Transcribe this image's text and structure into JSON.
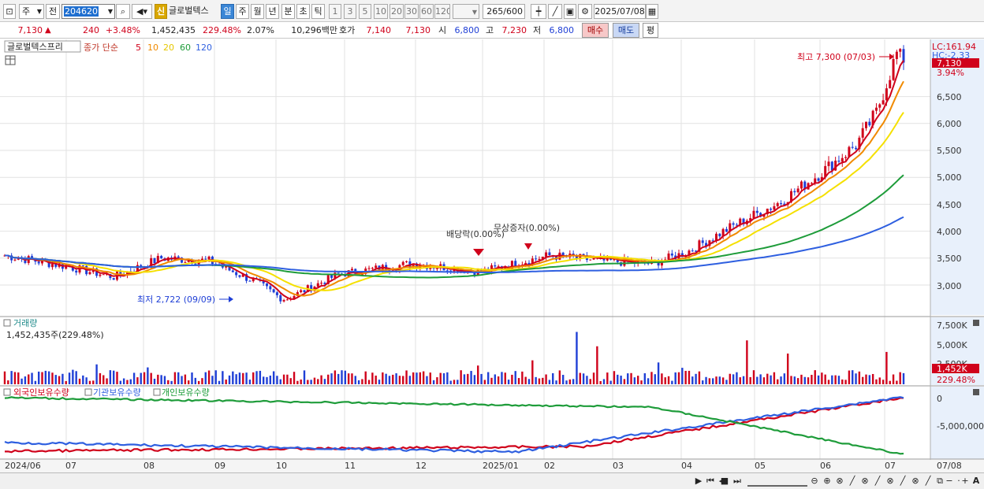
{
  "toolbar": {
    "type_select": "주",
    "prev_label": "전",
    "code": "204620",
    "stock_badge": "신",
    "stock_name": "글로벌텍스",
    "period_tabs": [
      "일",
      "주",
      "월",
      "년",
      "분",
      "초",
      "틱"
    ],
    "active_period": "일",
    "interval_buttons": [
      "1",
      "3",
      "5",
      "10",
      "20",
      "30",
      "60",
      "120"
    ],
    "count": "265",
    "count_max": "/600",
    "date": "2025/07/08"
  },
  "quote": {
    "price": "7,130",
    "change": "240",
    "change_pct": "+3.48%",
    "volume": "1,452,435",
    "volume_ratio": "229.48%",
    "turnover": "2.07%",
    "amount": "10,296백만",
    "hoga_label": "호가",
    "hoga_ask": "7,140",
    "hoga_bid": "7,130",
    "open_label": "시",
    "open": "6,800",
    "high_label": "고",
    "high": "7,230",
    "low_label": "저",
    "low": "6,800",
    "buy_label": "매수",
    "sell_label": "매도",
    "eval_label": "평"
  },
  "price_panel": {
    "title": "글로벌텍스프리",
    "ma_label": "종가 단순",
    "ma_periods": [
      "5",
      "10",
      "20",
      "60",
      "120"
    ],
    "ma_colors": [
      "#d0021b",
      "#f08a00",
      "#f5e000",
      "#1e9c3a",
      "#2e5fe0"
    ],
    "lc": "LC:161.94",
    "hc": "HC:-2.33",
    "last_price": "7,130",
    "last_pct": "3.94%",
    "high_note": "최고 7,300 (07/03)",
    "low_note": "최저 2,722 (09/09)",
    "event1": "배당락(0.00%)",
    "event2": "무상증자(0.00%)",
    "axis": [
      "6,500",
      "6,000",
      "5,500",
      "5,000",
      "4,500",
      "4,000",
      "3,500",
      "3,000"
    ]
  },
  "volume_panel": {
    "title": "거래량",
    "value": "1,452,435주(229.48%)",
    "axis": [
      "7,500K",
      "5,000K",
      "2,500K"
    ],
    "last_value": "1,452K",
    "last_pct": "229.48%"
  },
  "holdings_panel": {
    "legend": [
      "외국인보유수량",
      "기관보유수량",
      "개인보유수량"
    ],
    "colors": [
      "#d0021b",
      "#2e5fe0",
      "#1e9c3a"
    ],
    "axis": [
      "0",
      "-5,000,000"
    ]
  },
  "x_axis": {
    "labels": [
      "2024/06",
      "07",
      "08",
      "09",
      "10",
      "11",
      "12",
      "2025/01",
      "02",
      "03",
      "04",
      "05",
      "06",
      "07"
    ],
    "current_date": "07/08"
  },
  "chart_data": {
    "type": "line",
    "title": "",
    "x_range": [
      "2024/06",
      "2025/07/08"
    ],
    "y_range": [
      2722,
      7300
    ],
    "high": {
      "value": 7300,
      "date": "07/03"
    },
    "low": {
      "value": 2722,
      "date": "09/09"
    },
    "last_close": 7130,
    "series": [
      {
        "name": "5",
        "color": "#d0021b"
      },
      {
        "name": "10",
        "color": "#f08a00"
      },
      {
        "name": "20",
        "color": "#f5e000"
      },
      {
        "name": "60",
        "color": "#1e9c3a"
      },
      {
        "name": "120",
        "color": "#2e5fe0"
      }
    ]
  }
}
